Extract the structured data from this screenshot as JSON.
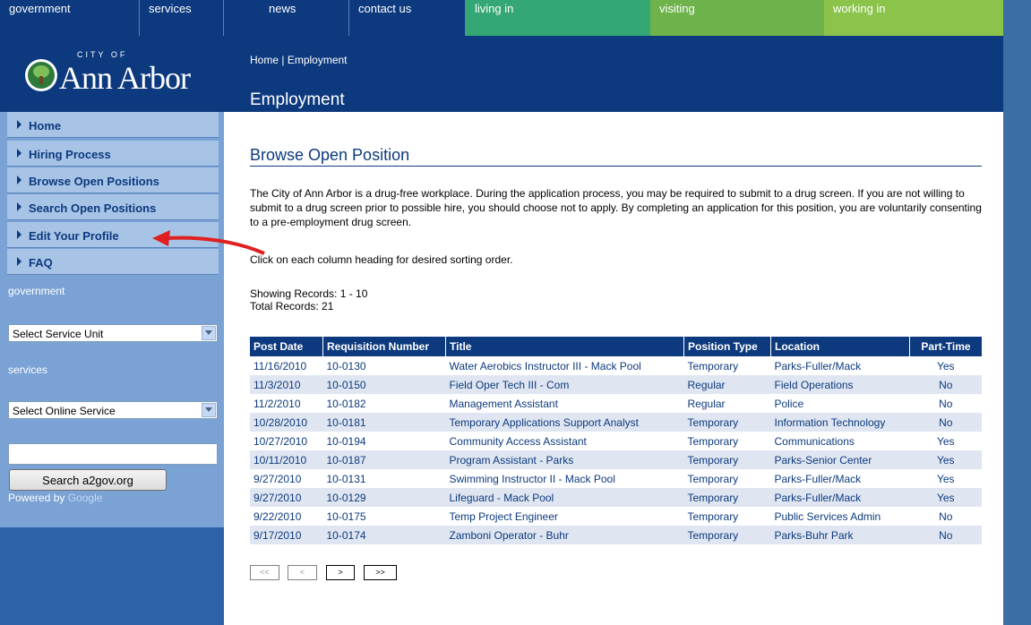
{
  "topnav": {
    "items": [
      {
        "label": "government"
      },
      {
        "label": "services"
      },
      {
        "label": "news"
      },
      {
        "label": "contact us"
      },
      {
        "label": "living in"
      },
      {
        "label": "visiting"
      },
      {
        "label": "working in"
      }
    ],
    "colors": [
      "#0d3a7e",
      "#0d3a7e",
      "#0d3a7e",
      "#0d3a7e",
      "#35a774",
      "#6db24b",
      "#8cc34b"
    ]
  },
  "logo": {
    "small": "CITY OF",
    "big": "Ann Arbor"
  },
  "sidebar": {
    "items": [
      {
        "label": "Home"
      },
      {
        "label": "Hiring Process"
      },
      {
        "label": "Browse Open Positions"
      },
      {
        "label": "Search Open Positions"
      },
      {
        "label": "Edit Your Profile"
      },
      {
        "label": "FAQ"
      }
    ],
    "government_label": "government",
    "service_unit": "Select Service Unit",
    "services_label": "services",
    "online_service": "Select Online Service",
    "search_value": "",
    "search_button": "Search a2gov.org",
    "powered_by": "Powered by",
    "google": "Google"
  },
  "header": {
    "breadcrumb": {
      "home": "Home",
      "sep": " | ",
      "current": "Employment"
    },
    "title": "Employment"
  },
  "main": {
    "section_title": "Browse Open Position",
    "notice": "The City of Ann Arbor is a drug-free workplace. During the application process, you may be required to submit to a drug screen. If you are not willing to submit to a drug screen prior to possible hire, you should choose not to apply. By completing an application for this position, you are voluntarily consenting to a pre-employment drug screen.",
    "sort_hint": "Click on each column heading for desired sorting order.",
    "showing": "Showing Records: 1 - 10",
    "total": "Total Records: 21",
    "columns": [
      "Post Date",
      "Requisition Number",
      "Title",
      "Position Type",
      "Location",
      "Part-Time"
    ],
    "rows": [
      [
        "11/16/2010",
        "10-0130",
        "Water Aerobics Instructor III - Mack Pool",
        "Temporary",
        "Parks-Fuller/Mack",
        "Yes"
      ],
      [
        "11/3/2010",
        "10-0150",
        "Field Oper Tech III - Com",
        "Regular",
        "Field Operations",
        "No"
      ],
      [
        "11/2/2010",
        "10-0182",
        "Management Assistant",
        "Regular",
        "Police",
        "No"
      ],
      [
        "10/28/2010",
        "10-0181",
        "Temporary Applications Support Analyst",
        "Temporary",
        "Information Technology",
        "No"
      ],
      [
        "10/27/2010",
        "10-0194",
        "Community Access Assistant",
        "Temporary",
        "Communications",
        "Yes"
      ],
      [
        "10/11/2010",
        "10-0187",
        "Program Assistant - Parks",
        "Temporary",
        "Parks-Senior Center",
        "Yes"
      ],
      [
        "9/27/2010",
        "10-0131",
        "Swimming Instructor II - Mack Pool",
        "Temporary",
        "Parks-Fuller/Mack",
        "Yes"
      ],
      [
        "9/27/2010",
        "10-0129",
        "Lifeguard - Mack Pool",
        "Temporary",
        "Parks-Fuller/Mack",
        "Yes"
      ],
      [
        "9/22/2010",
        "10-0175",
        "Temp Project Engineer",
        "Temporary",
        "Public Services Admin",
        "No"
      ],
      [
        "9/17/2010",
        "10-0174",
        "Zamboni Operator - Buhr",
        "Temporary",
        "Parks-Buhr Park",
        "No"
      ]
    ],
    "pager": {
      "first": "<<",
      "prev": "<",
      "next": ">",
      "last": ">>"
    }
  },
  "annotation": {
    "color": "#e02020"
  }
}
